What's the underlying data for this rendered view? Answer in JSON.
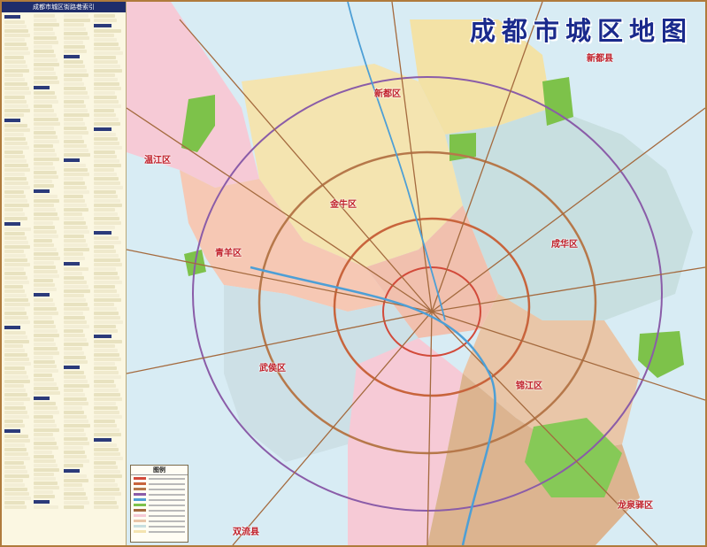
{
  "map": {
    "title": "成都市城区地图",
    "index_title": "成都市城区街路巷索引",
    "legend_title": "图例",
    "labels": [
      {
        "id": "xindu",
        "text": "新都区"
      },
      {
        "id": "xinjin",
        "text": "新都县"
      },
      {
        "id": "wenjiang",
        "text": "温江区"
      },
      {
        "id": "qingyang",
        "text": "青羊区"
      },
      {
        "id": "jinniu",
        "text": "金牛区"
      },
      {
        "id": "chenghua",
        "text": "成华区"
      },
      {
        "id": "wuhou",
        "text": "武侯区"
      },
      {
        "id": "jinjiang",
        "text": "锦江区"
      },
      {
        "id": "longquanyi",
        "text": "龙泉驿区"
      },
      {
        "id": "shuangliu",
        "text": "双流县"
      }
    ]
  },
  "colors": {
    "water": "#d8ecf4",
    "qingyang": "#f6c8b4",
    "jinniu": "#f4e4b0",
    "chenghua": "#c8dfe0",
    "wuhou": "#cde0e6",
    "jinjiang": "#e9c6a8",
    "pink": "#f6cad6",
    "green": "#7dc24a",
    "title": "#1a2a8c",
    "label": "#c0202a"
  }
}
